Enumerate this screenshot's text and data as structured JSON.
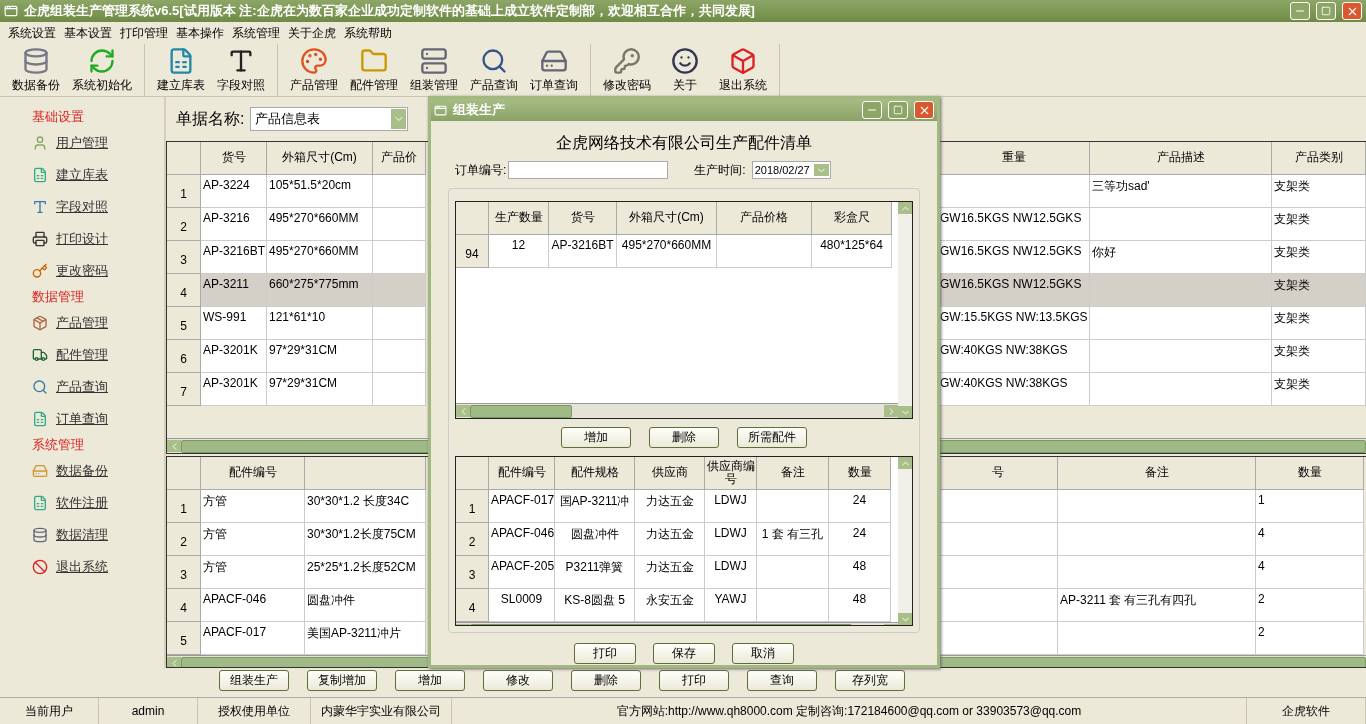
{
  "title_bar": {
    "title": "企虎组装生产管理系统v6.5[试用版本 注:企虎在为数百家企业成功定制软件的基础上成立软件定制部，欢迎相互合作，共同发展]"
  },
  "menu": [
    "系统设置",
    "基本设置",
    "打印管理",
    "基本操作",
    "系统管理",
    "关于企虎",
    "系统帮助"
  ],
  "toolbar": [
    [
      "数据备份",
      "系统初始化"
    ],
    [
      "建立库表",
      "字段对照"
    ],
    [
      "产品管理",
      "配件管理",
      "组装管理",
      "产品查询",
      "订单查询"
    ],
    [
      "修改密码",
      "关于",
      "退出系统"
    ]
  ],
  "sidebar": [
    {
      "title": "基础设置",
      "items": [
        "用户管理",
        "建立库表",
        "字段对照",
        "打印设计",
        "更改密码"
      ]
    },
    {
      "title": "数据管理",
      "items": [
        "产品管理",
        "配件管理",
        "产品查询",
        "订单查询"
      ]
    },
    {
      "title": "系统管理",
      "items": [
        "数据备份",
        "软件注册",
        "数据清理",
        "退出系统"
      ]
    }
  ],
  "form": {
    "label": "单据名称:",
    "value": "产品信息表"
  },
  "main_table": {
    "left_columns": [
      "货号",
      "外箱尺寸(Cm)",
      "产品价"
    ],
    "right_columns": [
      "重量",
      "产品描述",
      "产品类别"
    ],
    "rows": [
      {
        "number": "1",
        "item_no": "AP-3224",
        "carton_size": "105*51.5*20cm",
        "description": "三等功sad'",
        "category": "支架类",
        "selected": false
      },
      {
        "number": "2",
        "item_no": "AP-3216",
        "carton_size": "495*270*660MM",
        "weight": "GW16.5KGS NW12.5GKS",
        "category": "支架类",
        "selected": false
      },
      {
        "number": "3",
        "item_no": "AP-3216BT",
        "carton_size": "495*270*660MM",
        "weight": "GW16.5KGS NW12.5GKS",
        "description": "你好",
        "category": "支架类",
        "selected": false
      },
      {
        "number": "4",
        "item_no": "AP-3211",
        "carton_size": "660*275*775mm",
        "weight": "GW16.5KGS NW12.5GKS",
        "category": "支架类",
        "selected": true
      },
      {
        "number": "5",
        "item_no": "WS-991",
        "carton_size": "121*61*10",
        "weight": "GW:15.5KGS NW:13.5KGS",
        "category": "支架类",
        "selected": false
      },
      {
        "number": "6",
        "item_no": "AP-3201K",
        "carton_size": "97*29*31CM",
        "weight": "GW:40KGS  NW:38KGS",
        "category": "支架类",
        "selected": false
      },
      {
        "number": "7",
        "item_no": "AP-3201K",
        "carton_size": "97*29*31CM",
        "weight": "GW:40KGS  NW:38KGS",
        "category": "支架类",
        "selected": false
      }
    ]
  },
  "parts_table": {
    "left_columns": [
      "配件编号"
    ],
    "right_columns": [
      "号",
      "备注",
      "数量"
    ],
    "rows": [
      {
        "number": "1",
        "part_no": "方管",
        "column_2": "30*30*1.2  长度34C",
        "quantity": "1"
      },
      {
        "number": "2",
        "part_no": "方管",
        "column_2": "30*30*1.2长度75CM",
        "quantity": "4"
      },
      {
        "number": "3",
        "part_no": "方管",
        "column_2": "25*25*1.2长度52CM",
        "quantity": "4"
      },
      {
        "number": "4",
        "part_no": "APACF-046",
        "column_2": "圆盘冲件",
        "note": "AP-3211   套 有三孔有四孔",
        "quantity": "2"
      },
      {
        "number": "5",
        "part_no": "APACF-017",
        "column_2": "美国AP-3211冲片",
        "quantity": "2"
      }
    ]
  },
  "bottom_buttons": [
    "组装生产",
    "复制增加",
    "增加",
    "修改",
    "删除",
    "打印",
    "查询",
    "存列宽"
  ],
  "status_bar": [
    "当前用户",
    "admin",
    "授权使用单位",
    "内蒙华宇实业有限公司",
    "官方网站:http://www.qh8000.com 定制咨询:172184600@qq.com or 33903573@qq.com",
    "企虎软件"
  ],
  "dialog": {
    "title": "组装生产",
    "heading": "企虎网络技术有限公司生产配件清单",
    "order_field": {
      "label": "订单编号:"
    },
    "date_field": {
      "label": "生产时间:",
      "value": "2018/02/27"
    },
    "product_table": {
      "columns": [
        "生产数量",
        "货号",
        "外箱尺寸(Cm)",
        "产品价格",
        "彩盒尺"
      ],
      "rows": [
        {
          "number": "94",
          "quantity": "12",
          "item_no": "AP-3216BT",
          "carton_size": "495*270*660MM",
          "color_box_size": "480*125*64"
        }
      ]
    },
    "middle_buttons": [
      "增加",
      "删除",
      "所需配件"
    ],
    "parts_table": {
      "columns": [
        "配件编号",
        "配件规格",
        "供应商",
        "供应商编号",
        "备注",
        "数量"
      ],
      "rows": [
        {
          "number": "1",
          "part_no": "APACF-017",
          "spec": "国AP-3211冲",
          "supplier": "力达五金",
          "supplier_no": "LDWJ",
          "quantity": "24"
        },
        {
          "number": "2",
          "part_no": "APACF-046",
          "spec": "圆盘冲件",
          "supplier": "力达五金",
          "supplier_no": "LDWJ",
          "note": "1  套 有三孔",
          "quantity": "24"
        },
        {
          "number": "3",
          "part_no": "APACF-205",
          "spec": "P3211弹簧",
          "supplier": "力达五金",
          "supplier_no": "LDWJ",
          "quantity": "48"
        },
        {
          "number": "4",
          "part_no": "SL0009",
          "spec": "KS-8圆盘 5",
          "supplier": "永安五金",
          "supplier_no": "YAWJ",
          "quantity": "48"
        }
      ]
    },
    "buttons": [
      "打印",
      "保存",
      "取消"
    ]
  }
}
